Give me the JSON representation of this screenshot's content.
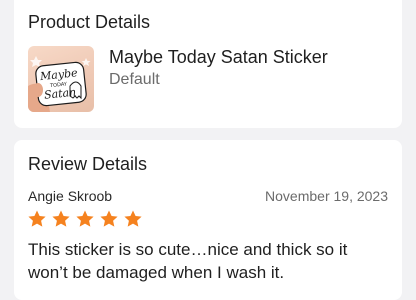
{
  "product_details": {
    "title": "Product Details",
    "item": {
      "name": "Maybe Today Satan Sticker",
      "variant": "Default",
      "image_text": {
        "line1": "Maybe",
        "line2": "TODAY",
        "line3": "Satan"
      }
    }
  },
  "review_details": {
    "title": "Review Details",
    "reviewer": "Angie Skroob",
    "date": "November 19, 2023",
    "rating": 5,
    "rating_max": 5,
    "star_color": "#f5821f",
    "text": "This sticker is so cute…nice and thick so it won’t be damaged when I wash it."
  }
}
